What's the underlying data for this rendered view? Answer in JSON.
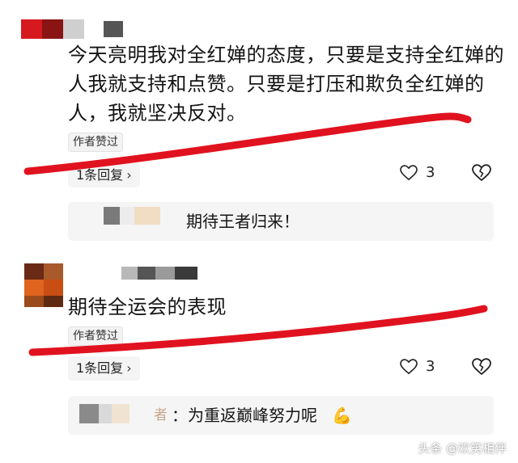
{
  "comments": [
    {
      "text_lines": [
        "今天亮明我对全红婵的态度，只要是支持全红婵的",
        "人我就支持和点赞。只要是打压和欺负全红婵的",
        "人，我就坚决反对。"
      ],
      "author_liked": "作者赞过",
      "reply_count": "1条回复",
      "like_count": "3",
      "reply_preview": "期待王者归来！"
    },
    {
      "text_lines": [
        "期待全运会的表现"
      ],
      "author_liked": "作者赞过",
      "reply_count": "1条回复",
      "like_count": "3",
      "reply_preview_author": "者",
      "reply_preview": "：为重返巅峰努力呢",
      "reply_emoji": "💪"
    }
  ],
  "watermark": "头条 @欢笑相伴",
  "colors": {
    "annotation_red": "#e1121f",
    "reply_bg": "#f5f5f5"
  }
}
